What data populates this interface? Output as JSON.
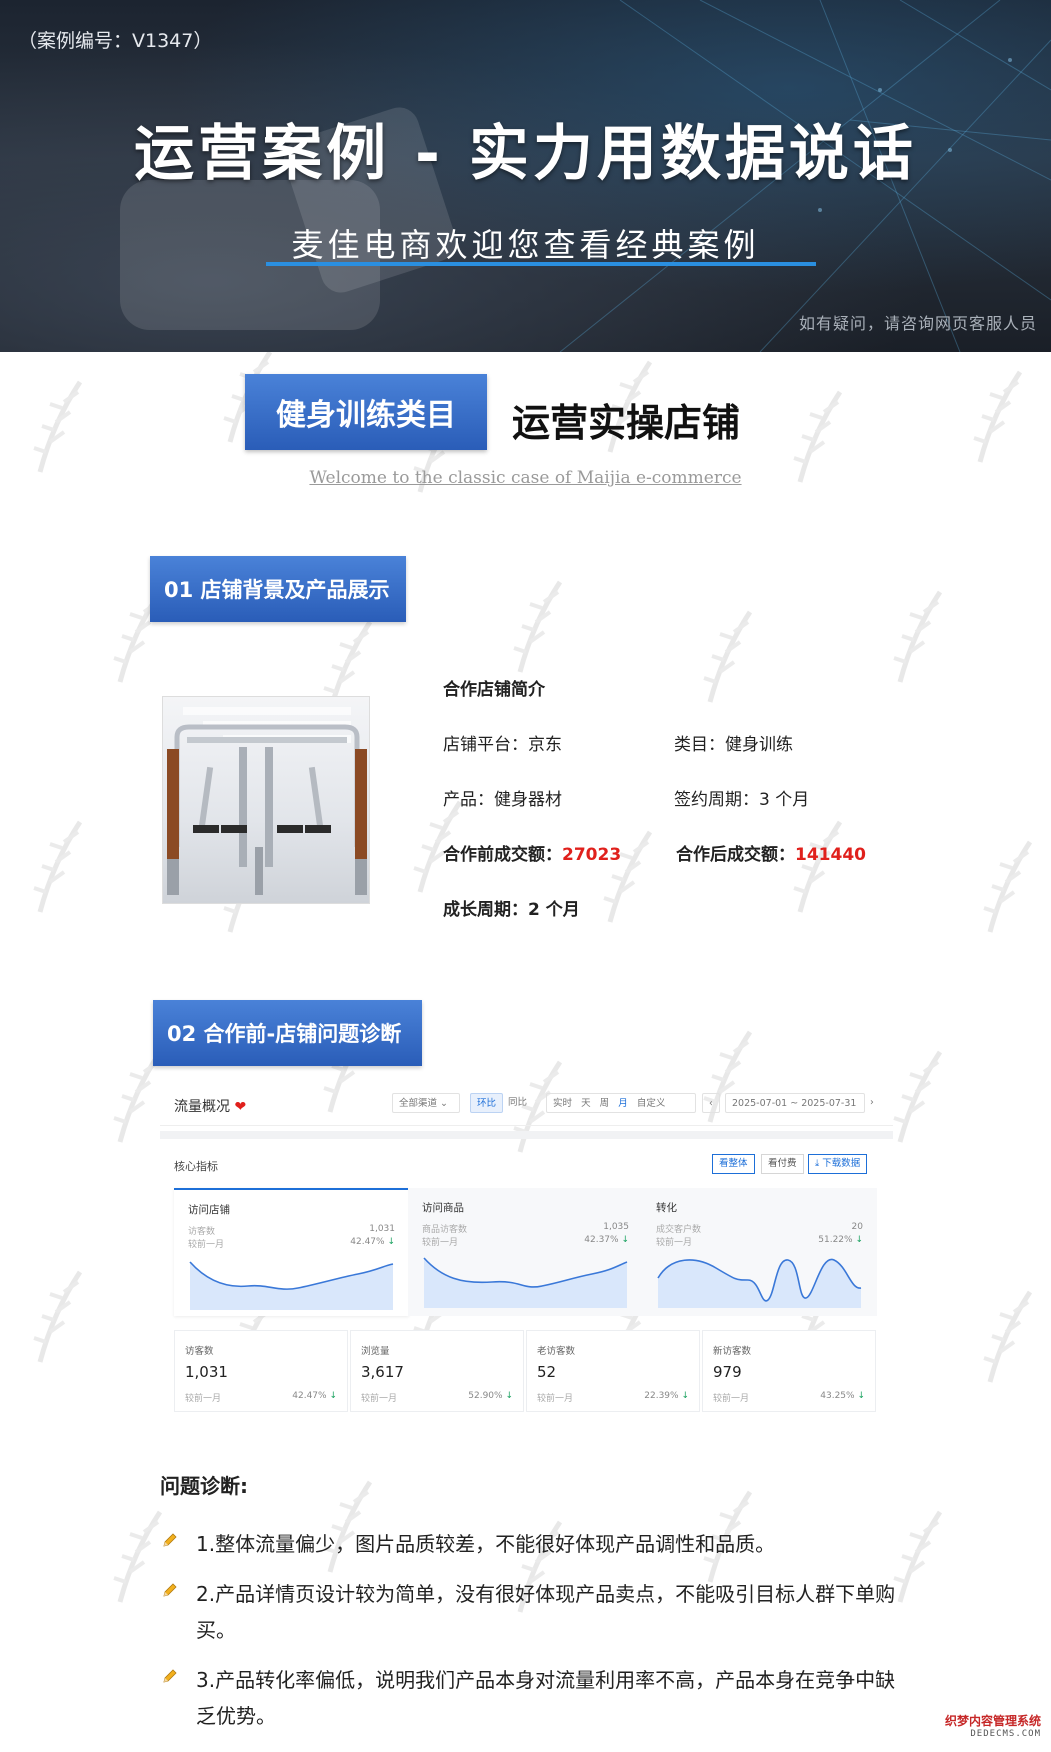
{
  "banner": {
    "case_number": "（案例编号：V1347）",
    "title": "运营案例 - 实力用数据说话",
    "subtitle": "麦佳电商欢迎您查看经典案例",
    "contact": "如有疑问，请咨询网页客服人员",
    "accent_color": "#2a8fe0"
  },
  "category": {
    "badge": "健身训练类目",
    "label": "运营实操店铺",
    "welcome": "Welcome to the classic case of Maijia e-commerce"
  },
  "section1": {
    "tag": "01 店铺背景及产品展示",
    "info_title": "合作店铺简介",
    "platform": "店铺平台：京东",
    "category": "类目：健身训练",
    "product": "产品：健身器材",
    "contract": "签约周期：3 个月",
    "before_label": "合作前成交额：",
    "before_value": "27023",
    "after_label": "合作后成交额：",
    "after_value": "141440",
    "growth": "成长周期：2 个月"
  },
  "section2": {
    "tag": "02 合作前-店铺问题诊断"
  },
  "dashboard": {
    "title": "流量概况",
    "channel": "全部渠道",
    "compare_a": "环比",
    "compare_b": "同比",
    "periods": [
      "实时",
      "天",
      "周",
      "月",
      "自定义"
    ],
    "date_range": "2025-07-01 ~ 2025-07-31",
    "core": "核心指标",
    "buttons": [
      "看整体",
      "看付费",
      "下载数据"
    ],
    "panels": [
      {
        "title": "访问店铺",
        "line1": "访客数",
        "line2": "较前一月",
        "value": "1,031",
        "pct": "42.47%"
      },
      {
        "title": "访问商品",
        "line1": "商品访客数",
        "line2": "较前一月",
        "value": "1,035",
        "pct": "42.37%"
      },
      {
        "title": "转化",
        "line1": "成交客户数",
        "line2": "较前一月",
        "value": "20",
        "pct": "51.22%"
      }
    ],
    "kpis": [
      {
        "label": "访客数",
        "value": "1,031",
        "sub": "较前一月",
        "pct": "42.47%"
      },
      {
        "label": "浏览量",
        "value": "3,617",
        "sub": "较前一月",
        "pct": "52.90%"
      },
      {
        "label": "老访客数",
        "value": "52",
        "sub": "较前一月",
        "pct": "22.39%"
      },
      {
        "label": "新访客数",
        "value": "979",
        "sub": "较前一月",
        "pct": "43.25%"
      }
    ],
    "down_arrow": "↓"
  },
  "diagnosis": {
    "heading": "问题诊断:",
    "items": [
      "1.整体流量偏少，图片品质较差，不能很好体现产品调性和品质。",
      "2.产品详情页设计较为简单，没有很好体现产品卖点，不能吸引目标人群下单购买。",
      "3.产品转化率偏低，说明我们产品本身对流量利用率不高，产品本身在竞争中缺乏优势。"
    ]
  },
  "footer": {
    "logo_text": "织梦内容管理系统",
    "logo_domain": "DEDECMS.COM"
  }
}
